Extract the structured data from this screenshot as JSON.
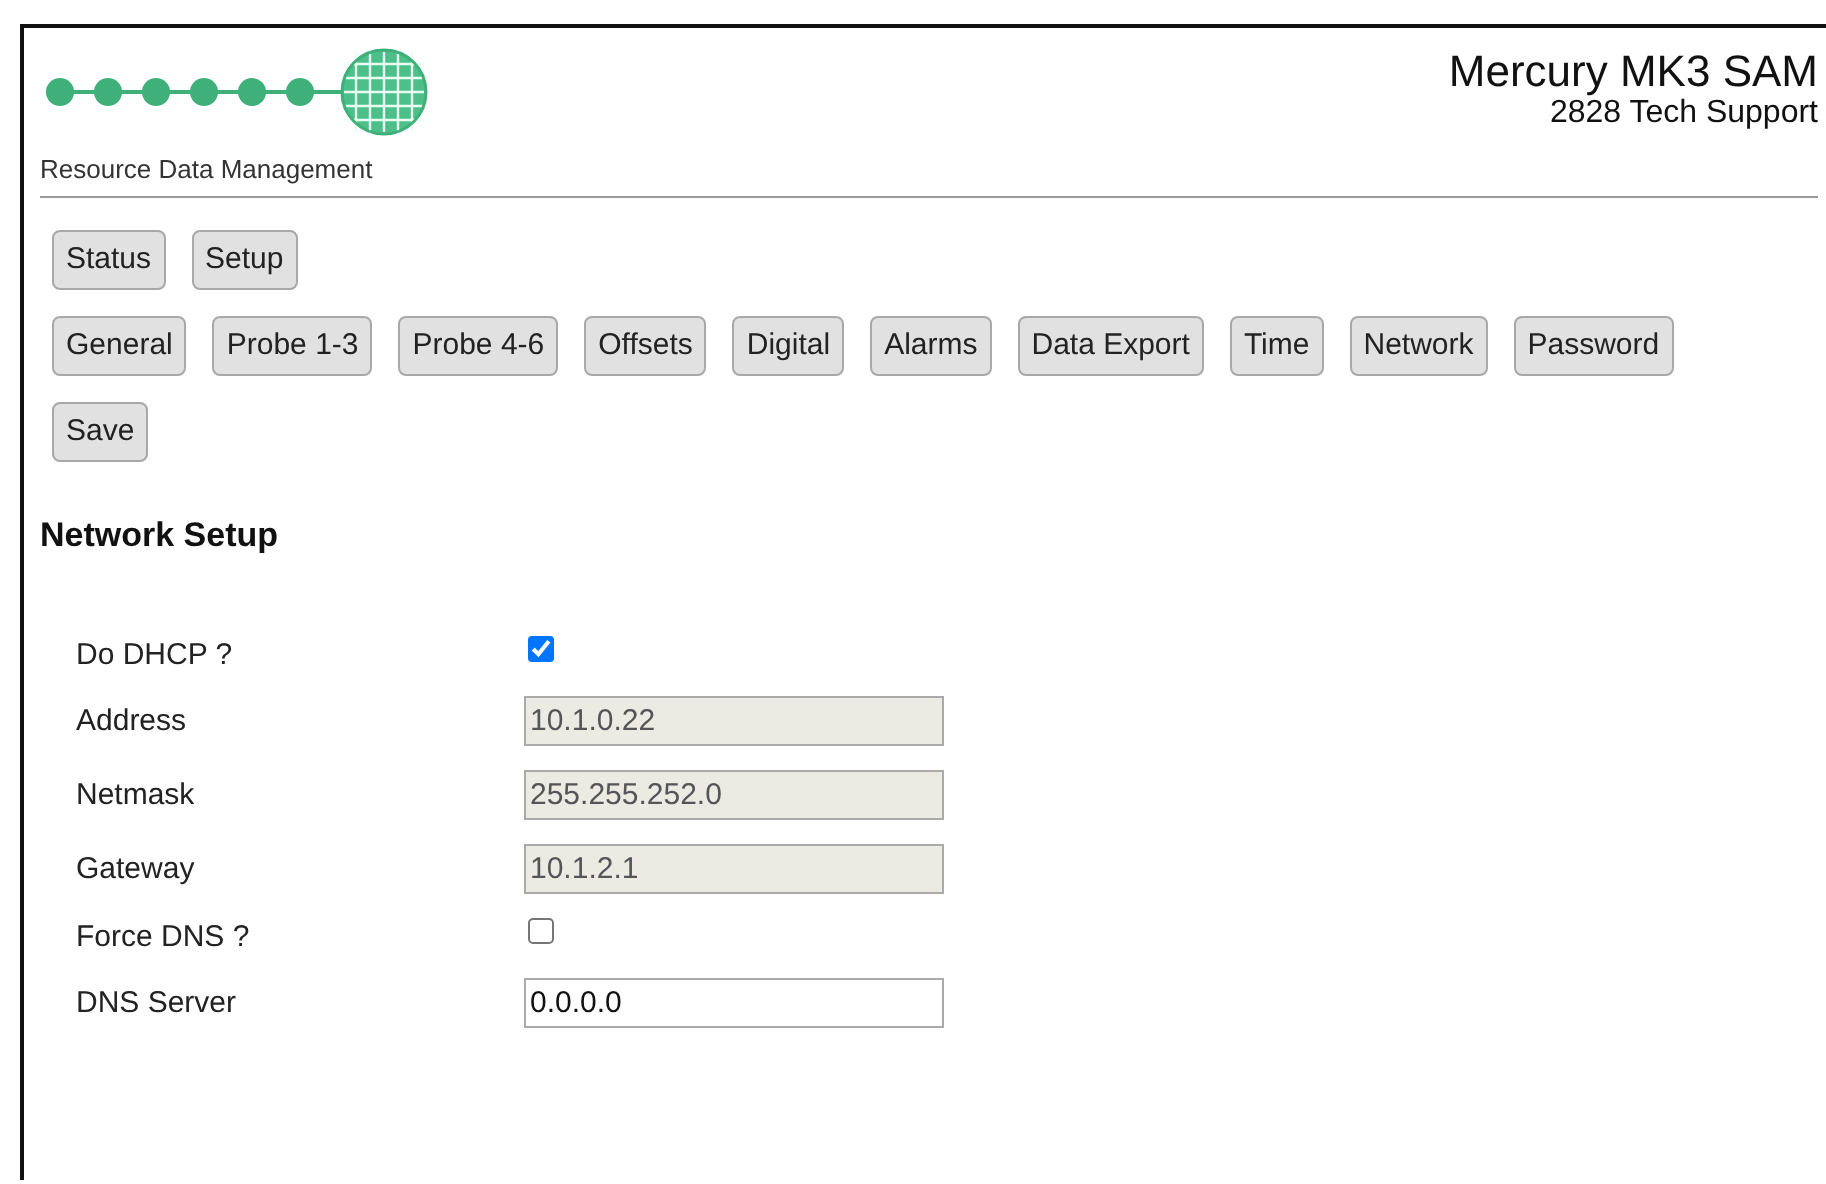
{
  "header": {
    "brand": "Resource Data Management",
    "title": "Mercury MK3 SAM",
    "subtitle": "2828 Tech Support"
  },
  "nav_rows": [
    [
      "Status",
      "Setup"
    ],
    [
      "General",
      "Probe 1-3",
      "Probe 4-6",
      "Offsets",
      "Digital",
      "Alarms",
      "Data Export",
      "Time",
      "Network",
      "Password"
    ],
    [
      "Save"
    ]
  ],
  "section_title": "Network Setup",
  "fields": [
    {
      "kind": "checkbox",
      "label": "Do DHCP ?",
      "checked": true
    },
    {
      "kind": "text",
      "label": "Address",
      "value": "10.1.0.22",
      "disabled": true
    },
    {
      "kind": "text",
      "label": "Netmask",
      "value": "255.255.252.0",
      "disabled": true
    },
    {
      "kind": "text",
      "label": "Gateway",
      "value": "10.1.2.1",
      "disabled": true
    },
    {
      "kind": "checkbox",
      "label": "Force DNS ?",
      "checked": false
    },
    {
      "kind": "text",
      "label": "DNS Server",
      "value": "0.0.0.0",
      "disabled": false
    }
  ]
}
